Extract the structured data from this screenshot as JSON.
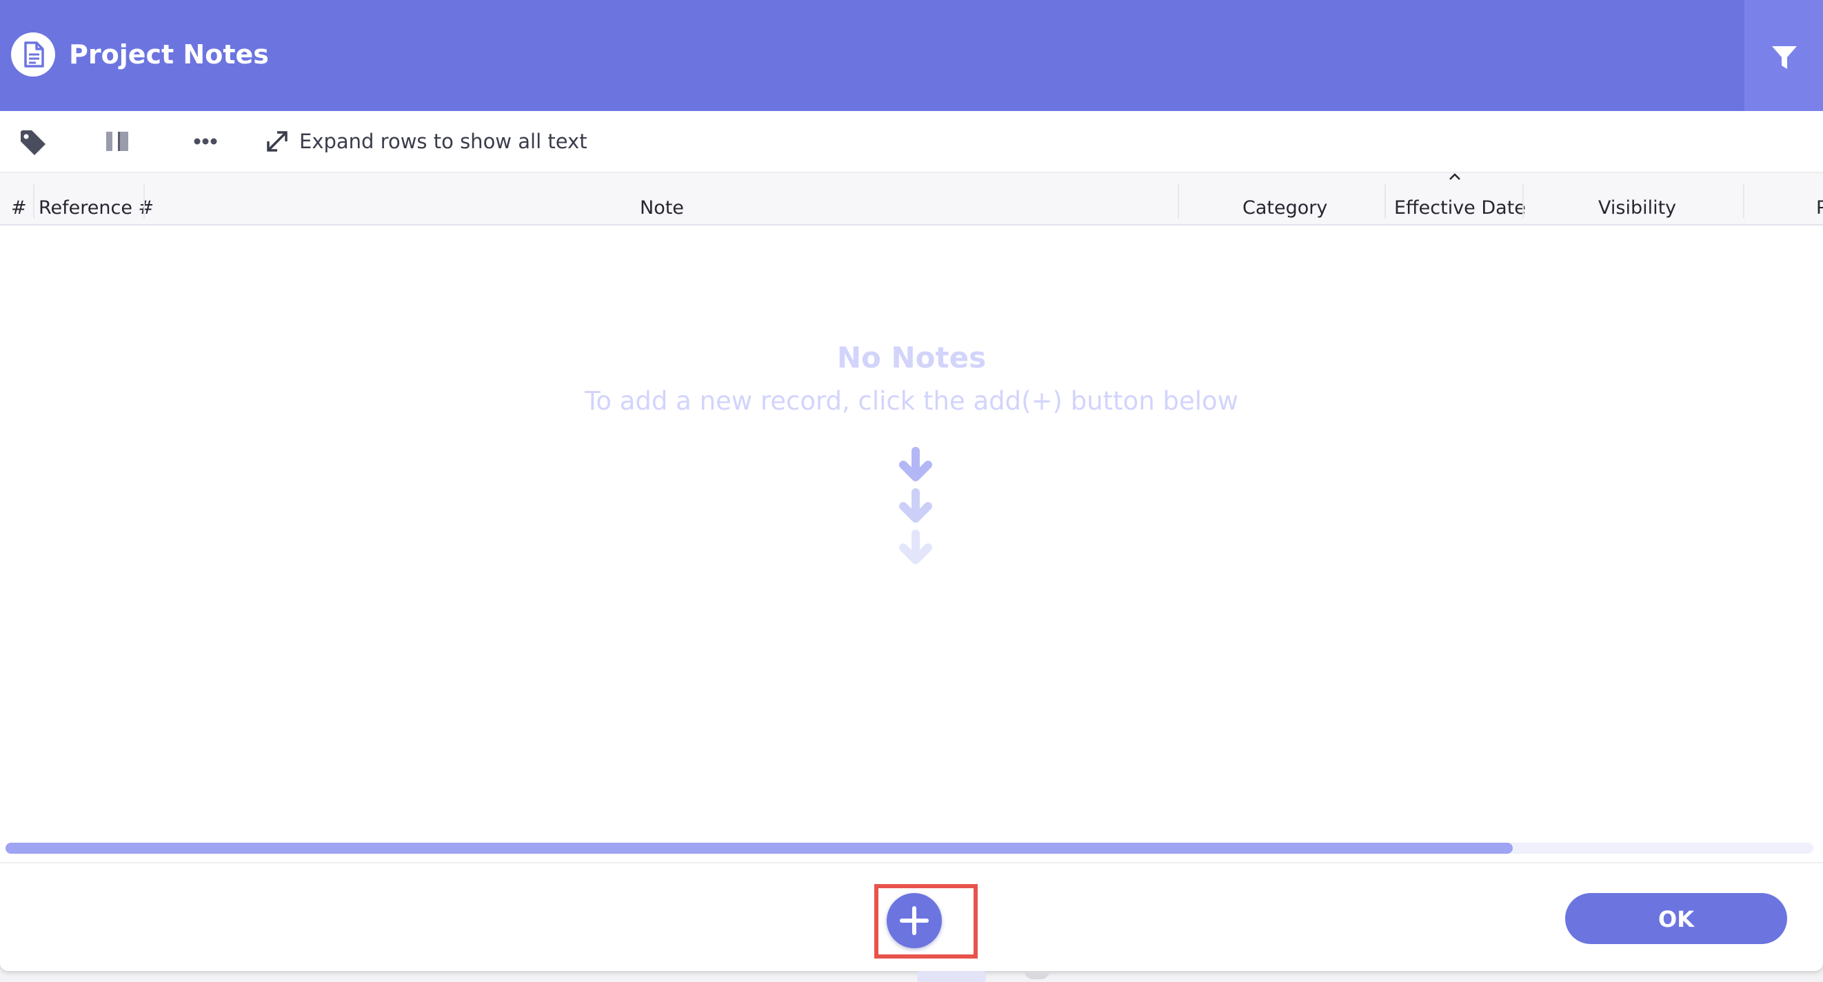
{
  "window": {
    "title": "Project Notes",
    "icon": "document-icon",
    "filter_icon": "filter-icon"
  },
  "toolbar": {
    "tag_icon": "tag-icon",
    "columns_icon": "columns-icon",
    "more_icon": "more-dots-icon",
    "expand_icon": "expand-arrows-icon",
    "expand_label": "Expand rows to show all text"
  },
  "table": {
    "columns": [
      {
        "key": "index",
        "label": "#"
      },
      {
        "key": "reference",
        "label": "Reference #"
      },
      {
        "key": "note",
        "label": "Note"
      },
      {
        "key": "category",
        "label": "Category"
      },
      {
        "key": "effective_date",
        "label": "Effective Date",
        "sorted": "ascending"
      },
      {
        "key": "visibility",
        "label": "Visibility"
      },
      {
        "key": "truncated",
        "label": "P"
      }
    ],
    "rows": []
  },
  "empty_state": {
    "title": "No Notes",
    "message": "To add a new record, click the add(+) button below",
    "icon": "down-arrows-icon"
  },
  "footer": {
    "add_icon": "plus-icon",
    "ok_label": "OK"
  },
  "colors": {
    "accent": "#6c74e0",
    "highlight": "#e8534c",
    "empty_text": "#d2d4fb"
  }
}
